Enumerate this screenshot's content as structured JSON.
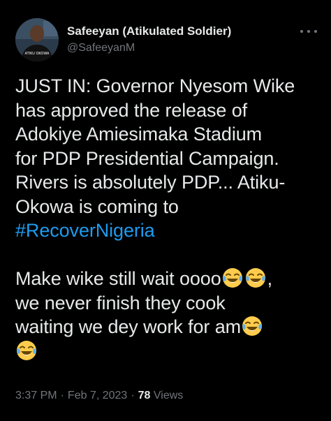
{
  "tweet": {
    "author": {
      "display_name": "Safeeyan (Atikulated Soldier)",
      "handle": "@SafeeyanM",
      "avatar_shirt_text": "ATIKU OKOWA"
    },
    "more_icon": "more-horizontal-icon",
    "lines": [
      "JUST IN: Governor Nyesom Wike",
      "has approved the release of",
      "Adokiye Amiesimaka Stadium",
      "for PDP Presidential Campaign.",
      "Rivers is absolutely PDP... Atiku-",
      "Okowa is coming to"
    ],
    "hashtag": "#RecoverNigeria",
    "second_paragraph": {
      "line1": "Make wike still wait oooo",
      "line1_end": ",",
      "line2": "we never finish they cook",
      "line3": "waiting we dey work for am"
    },
    "emoji_name": "face-with-tears-of-joy-icon",
    "time": "3:37 PM",
    "date": "Feb 7, 2023",
    "separator": "·",
    "views_count": "78",
    "views_label": "Views"
  },
  "colors": {
    "background": "#000000",
    "text": "#e7e9ea",
    "secondary": "#71767b",
    "link": "#1d9bf0"
  }
}
